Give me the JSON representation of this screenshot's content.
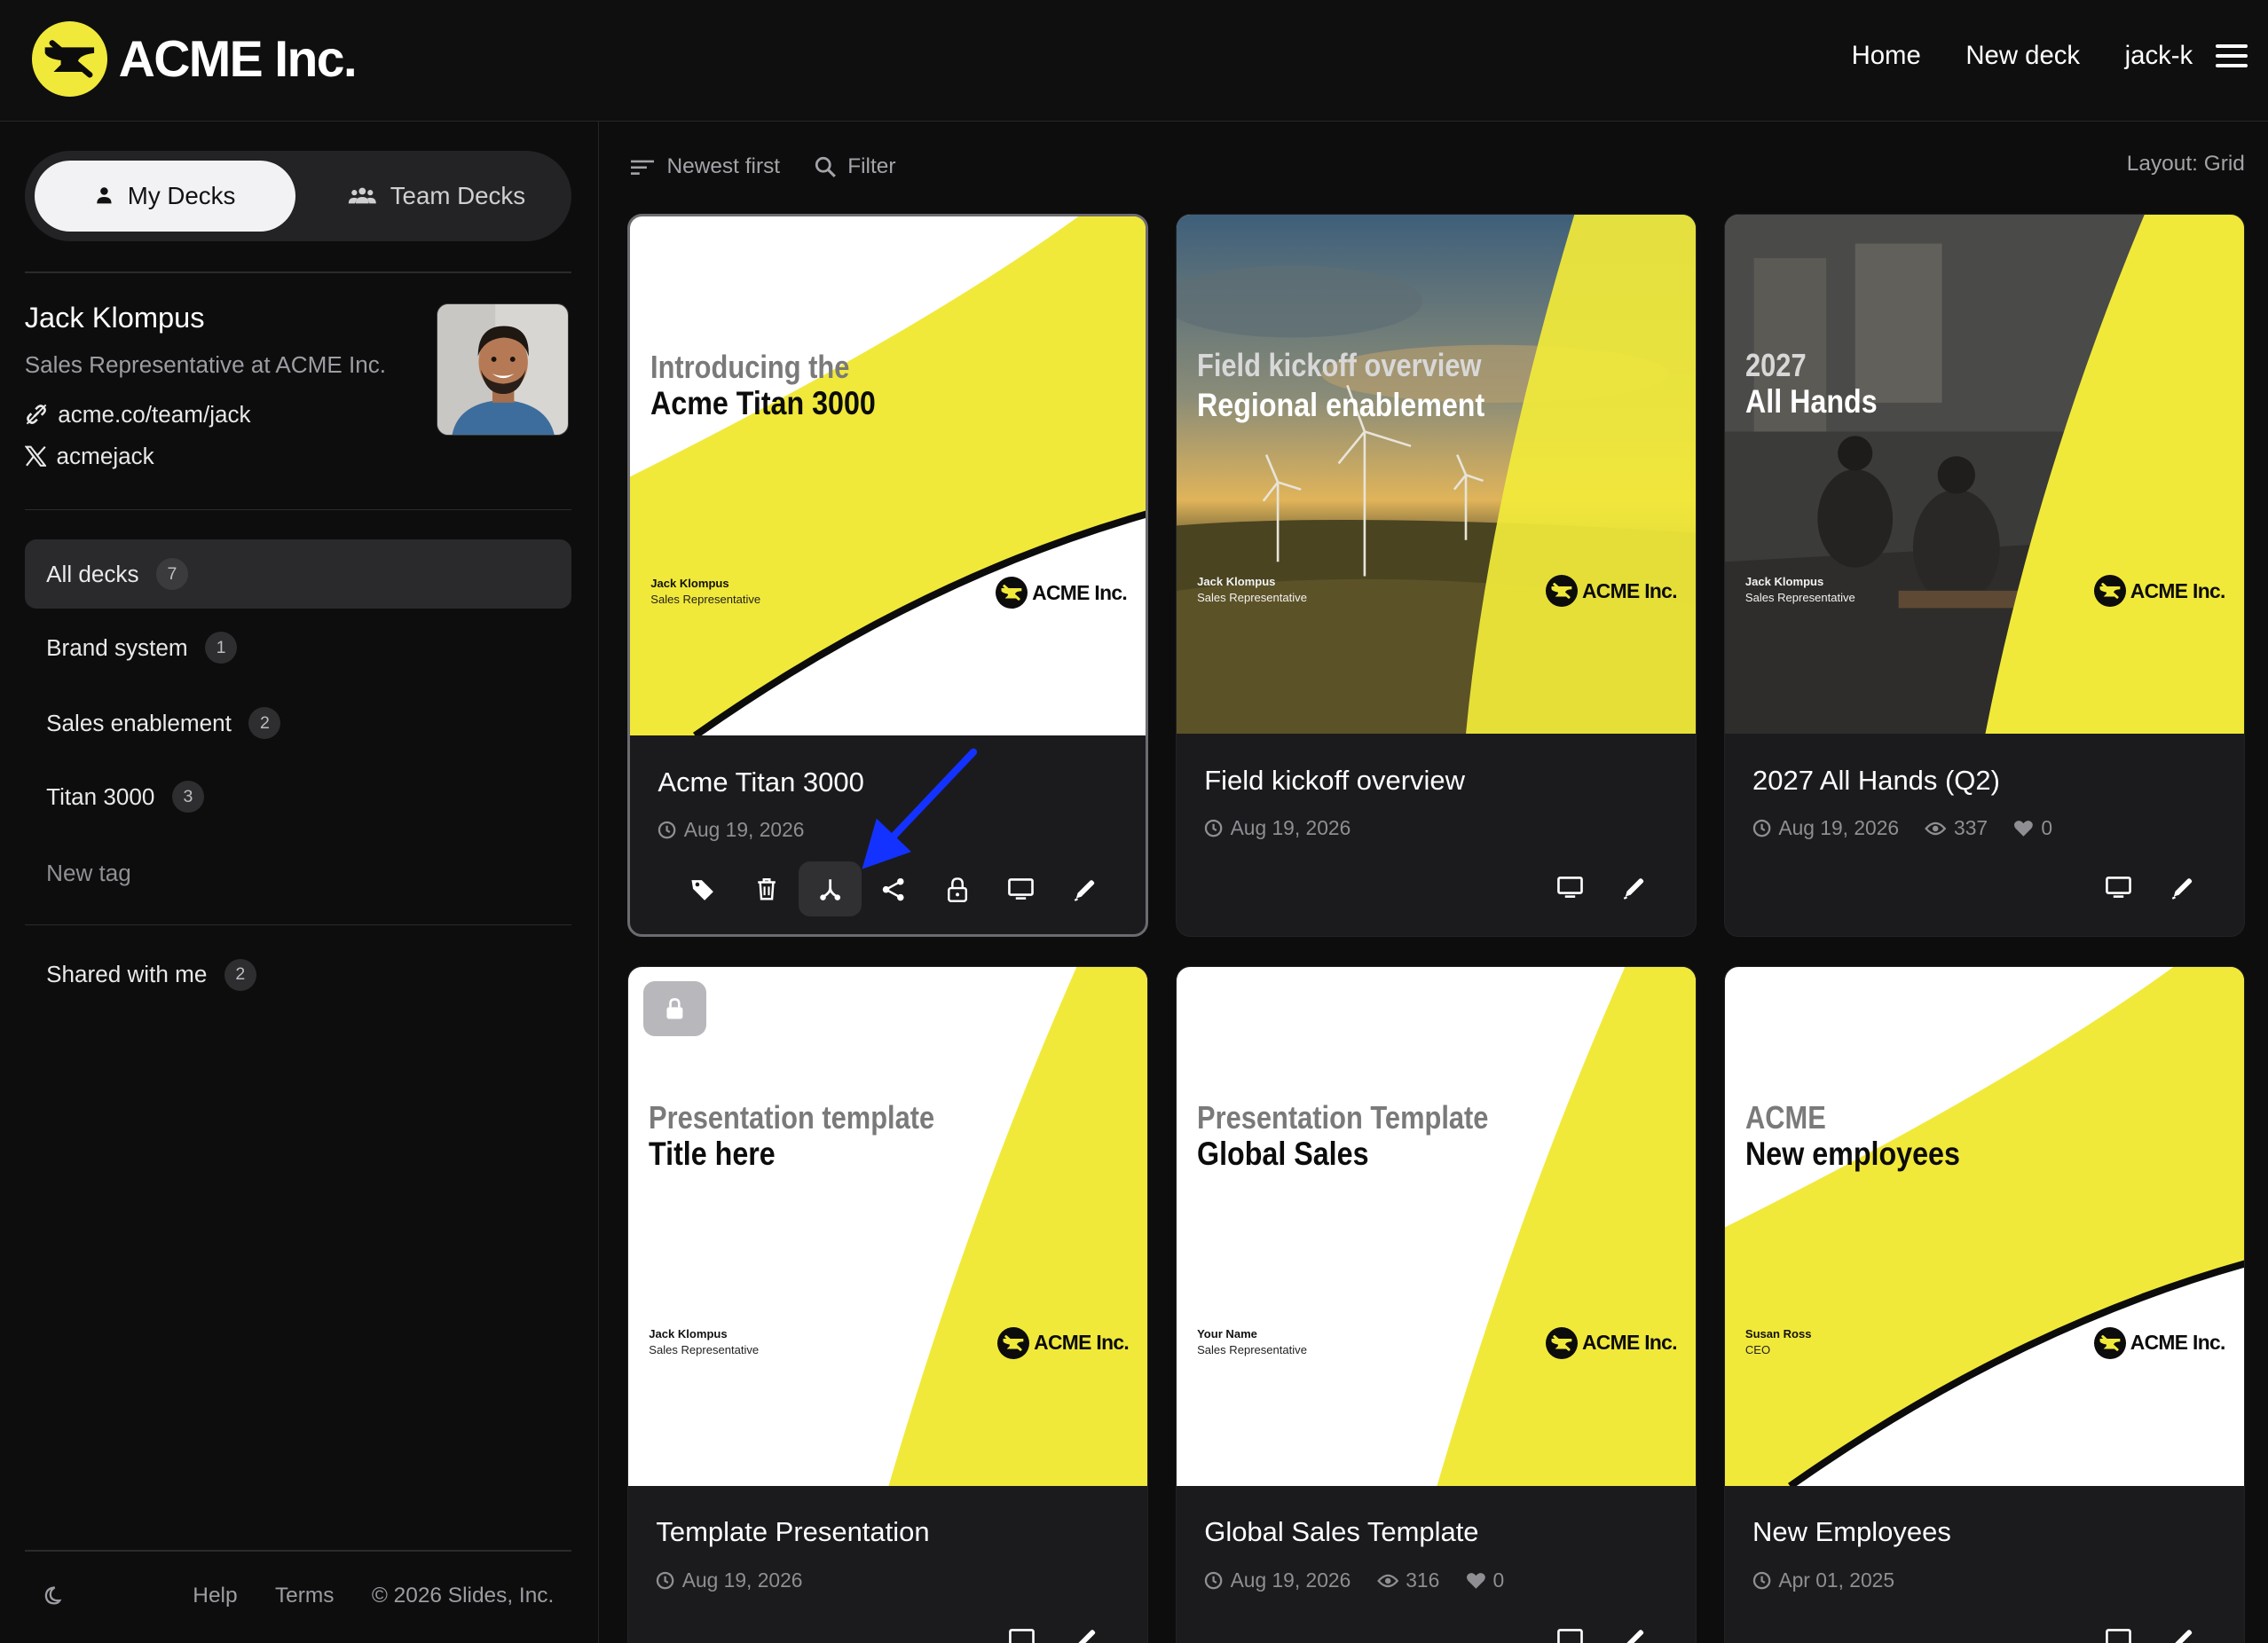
{
  "app": {
    "brand_name": "ACME Inc.",
    "nav": {
      "home": "Home",
      "new_deck": "New deck",
      "user": "jack-k"
    }
  },
  "sidebar": {
    "tabs": {
      "my_decks": "My Decks",
      "team_decks": "Team Decks"
    },
    "profile": {
      "name": "Jack Klompus",
      "role": "Sales Representative at ACME Inc.",
      "website": "acme.co/team/jack",
      "x_handle": "acmejack"
    },
    "tags": [
      {
        "label": "All decks",
        "count": "7"
      },
      {
        "label": "Brand system",
        "count": "1"
      },
      {
        "label": "Sales enablement",
        "count": "2"
      },
      {
        "label": "Titan 3000",
        "count": "3"
      }
    ],
    "new_tag": "New tag",
    "shared": {
      "label": "Shared with me",
      "count": "2"
    },
    "footer": {
      "help": "Help",
      "terms": "Terms",
      "copyright": "© 2026 Slides, Inc."
    }
  },
  "toolbar": {
    "sort": "Newest first",
    "filter": "Filter",
    "layout": "Layout: Grid"
  },
  "colors": {
    "accent_yellow": "#f1e93a",
    "annotation_arrow": "#1432ff",
    "background": "#0d0d0e",
    "card": "#1b1b1d"
  },
  "decks": [
    {
      "title": "Acme Titan 3000",
      "date": "Aug 19, 2026",
      "thumb_line1": "Introducing the",
      "thumb_line2": "Acme Titan 3000",
      "author": "Jack Klompus",
      "author_role": "Sales Representative",
      "logo_text": "ACME Inc."
    },
    {
      "title": "Field kickoff overview",
      "date": "Aug 19, 2026",
      "thumb_line1": "Field kickoff overview",
      "thumb_line2": "Regional enablement",
      "author": "Jack Klompus",
      "author_role": "Sales Representative",
      "logo_text": "ACME Inc."
    },
    {
      "title": "2027 All Hands (Q2)",
      "date": "Aug 19, 2026",
      "views": "337",
      "likes": "0",
      "thumb_line1": "2027",
      "thumb_line2": "All Hands",
      "author": "Jack Klompus",
      "author_role": "Sales Representative",
      "logo_text": "ACME Inc."
    },
    {
      "title": "Template Presentation",
      "date": "Aug 19, 2026",
      "thumb_line1": "Presentation template",
      "thumb_line2": "Title here",
      "author": "Jack Klompus",
      "author_role": "Sales Representative",
      "logo_text": "ACME Inc."
    },
    {
      "title": "Global Sales Template",
      "date": "Aug 19, 2026",
      "views": "316",
      "likes": "0",
      "thumb_line1": "Presentation Template",
      "thumb_line2": "Global Sales",
      "author": "Your Name",
      "author_role": "Sales Representative",
      "logo_text": "ACME Inc."
    },
    {
      "title": "New Employees",
      "date": "Apr 01, 2025",
      "thumb_line1": "ACME",
      "thumb_line2": "New employees",
      "author": "Susan Ross",
      "author_role": "CEO",
      "logo_text": "ACME Inc."
    }
  ],
  "card_actions": [
    "tag-icon",
    "trash-icon",
    "fork-icon",
    "share-icon",
    "lock-icon",
    "present-icon",
    "edit-pen-icon"
  ]
}
